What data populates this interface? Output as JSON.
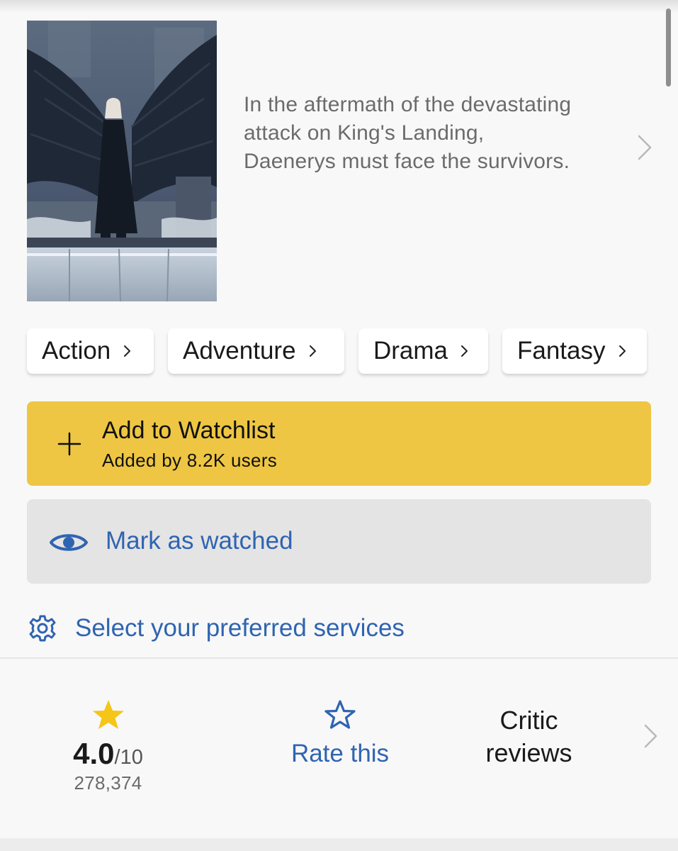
{
  "episode": {
    "plot": "In the aftermath of the devastating attack on King's Landing, Daenerys must face the survivors."
  },
  "genres": [
    {
      "label": "Action"
    },
    {
      "label": "Adventure"
    },
    {
      "label": "Drama"
    },
    {
      "label": "Fantasy"
    }
  ],
  "watchlist": {
    "title": "Add to Watchlist",
    "subtitle": "Added by 8.2K users"
  },
  "watched": {
    "label": "Mark as watched"
  },
  "services": {
    "label": "Select your preferred services"
  },
  "rating": {
    "value": "4.0",
    "scale": "/10",
    "count": "278,374",
    "rate_label": "Rate this",
    "critic_line1": "Critic",
    "critic_line2": "reviews"
  },
  "icons": {
    "plus": "plus-icon",
    "eye": "eye-icon",
    "gear": "gear-icon",
    "star_filled": "star-filled-icon",
    "star_outline": "star-outline-icon",
    "chevron": "chevron-right-icon"
  },
  "colors": {
    "accent_yellow": "#eec643",
    "link_blue": "#2f64b1",
    "watched_bg": "#e4e4e4",
    "star_gold": "#f5c518"
  }
}
